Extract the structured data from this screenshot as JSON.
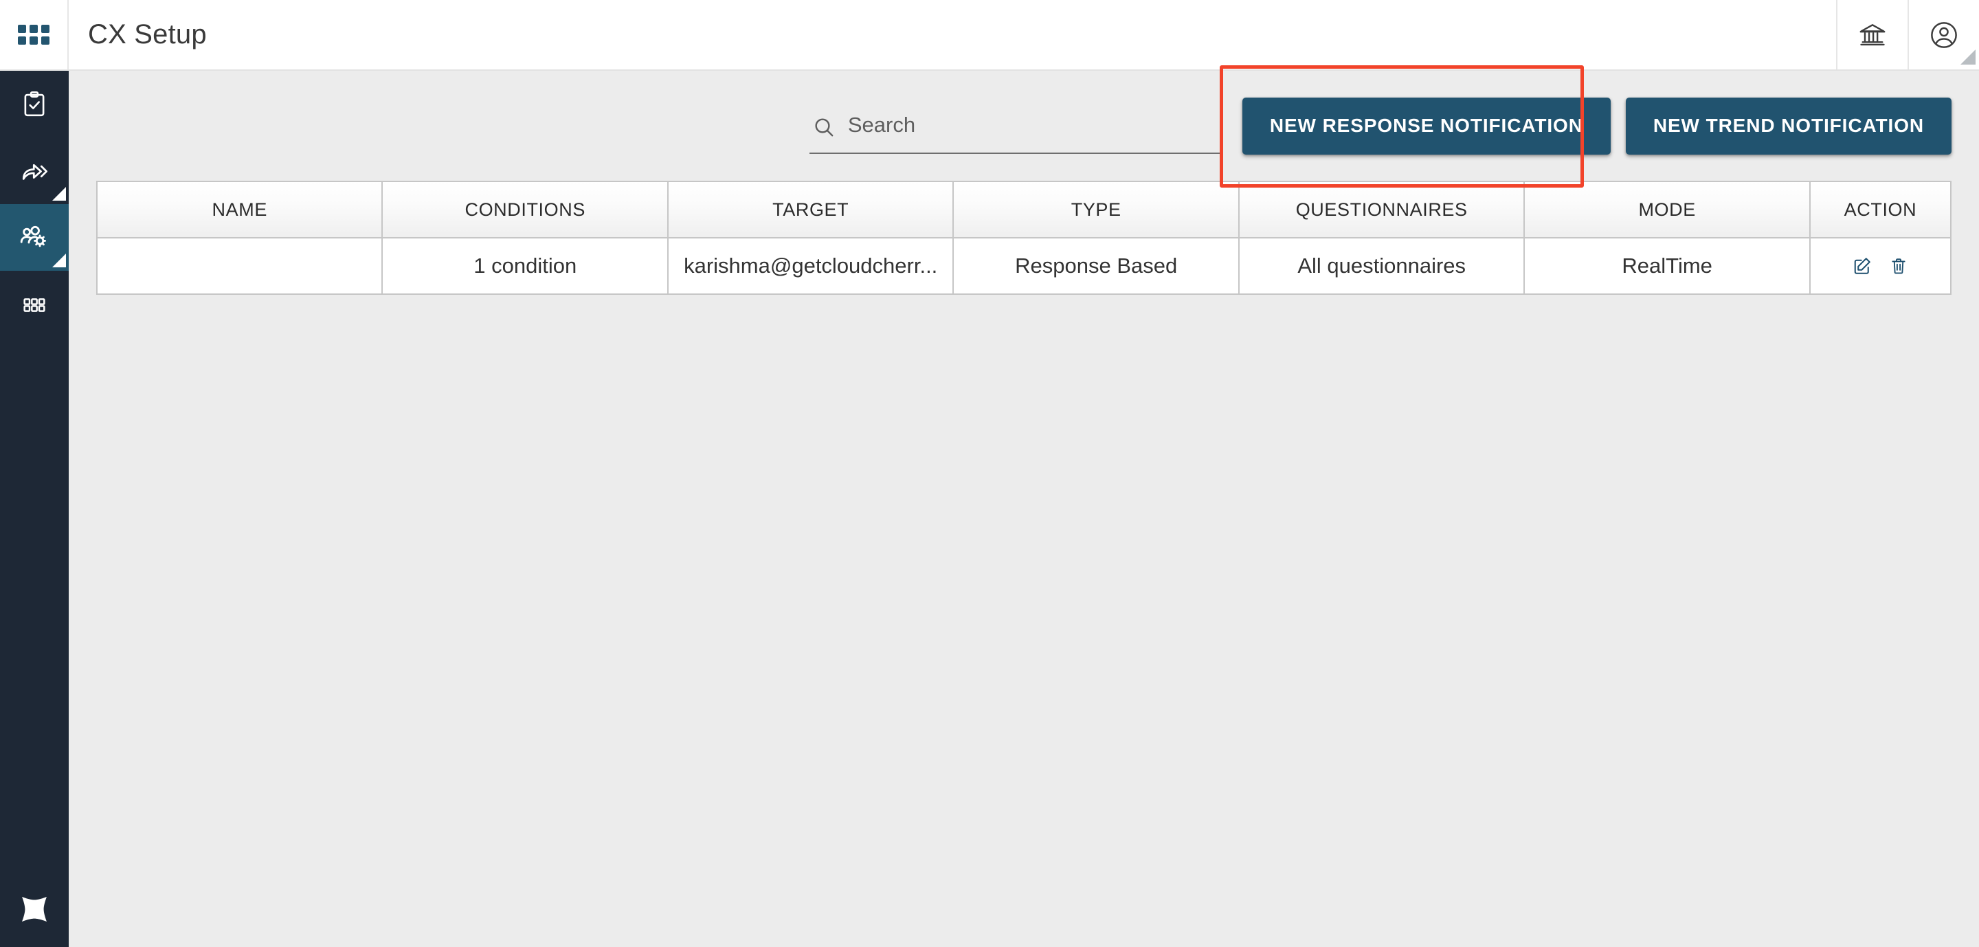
{
  "app": {
    "title": "CX Setup",
    "accent_blue": "#21536f",
    "rail_bg": "#1e2836",
    "active_rail_bg": "#23576f",
    "highlight_color": "#f2432a",
    "page_bg": "#ececec"
  },
  "topbar": {
    "apps_icon": "apps-grid-icon",
    "title": "CX Setup",
    "actions": [
      {
        "icon": "bank-icon",
        "name": "organization"
      },
      {
        "icon": "account-circle-icon",
        "name": "user-account"
      }
    ]
  },
  "sidebar": {
    "items": [
      {
        "icon": "clipboard-check-icon",
        "name": "surveys",
        "active": false,
        "has_corner": false
      },
      {
        "icon": "share-forward-icon",
        "name": "distribution",
        "active": false,
        "has_corner": true
      },
      {
        "icon": "users-gear-icon",
        "name": "cx-setup",
        "active": true,
        "has_corner": true
      },
      {
        "icon": "dashboard-grid-icon",
        "name": "dashboards",
        "active": false,
        "has_corner": false
      }
    ],
    "logo": "four-point-star-logo"
  },
  "toolbar": {
    "search": {
      "placeholder": "Search",
      "value": "",
      "icon": "search-icon"
    },
    "new_response_notification_label": "NEW RESPONSE NOTIFICATION",
    "new_trend_notification_label": "NEW TREND NOTIFICATION"
  },
  "table": {
    "columns": [
      "NAME",
      "CONDITIONS",
      "TARGET",
      "TYPE",
      "QUESTIONNAIRES",
      "MODE",
      "ACTION"
    ],
    "rows": [
      {
        "name": "",
        "conditions": "1 condition",
        "target": "karishma@getcloudcherr...",
        "type": "Response Based",
        "questionnaires": "All questionnaires",
        "mode": "RealTime",
        "actions": [
          {
            "icon": "edit-icon",
            "label": "Edit"
          },
          {
            "icon": "trash-icon",
            "label": "Delete"
          }
        ]
      }
    ]
  }
}
